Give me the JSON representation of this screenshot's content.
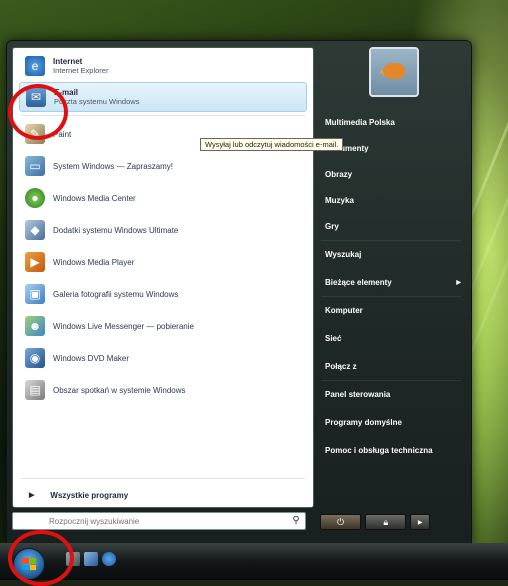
{
  "pinned": [
    {
      "title": "Internet",
      "subtitle": "Internet Explorer",
      "icon": "internet-explorer-icon"
    },
    {
      "title": "E-mail",
      "subtitle": "Poczta systemu Windows",
      "icon": "mail-icon"
    }
  ],
  "recent": [
    {
      "label": "Paint",
      "icon": "paint-icon"
    },
    {
      "label": "System Windows — Zapraszamy!",
      "icon": "welcome-icon"
    },
    {
      "label": "Windows Media Center",
      "icon": "media-center-icon"
    },
    {
      "label": "Dodatki systemu Windows Ultimate",
      "icon": "ultimate-extras-icon"
    },
    {
      "label": "Windows Media Player",
      "icon": "media-player-icon"
    },
    {
      "label": "Galeria fotografii systemu Windows",
      "icon": "photo-gallery-icon"
    },
    {
      "label": "Windows Live Messenger — pobieranie",
      "icon": "messenger-icon"
    },
    {
      "label": "Windows DVD Maker",
      "icon": "dvd-maker-icon"
    },
    {
      "label": "Obszar spotkań w systemie Windows",
      "icon": "meeting-space-icon"
    }
  ],
  "all_programs": "Wszystkie programy",
  "search": {
    "placeholder": "Rozpocznij wyszukiwanie"
  },
  "right_items": [
    "Multimedia Polska",
    "Dokumenty",
    "Obrazy",
    "Muzyka",
    "Gry",
    "Wyszukaj",
    "Bieżące elementy",
    "Komputer",
    "Sieć",
    "Połącz z",
    "Panel sterowania",
    "Programy domyślne",
    "Pomoc i obsługa techniczna"
  ],
  "tooltip": "Wysyłaj lub odczytuj wiadomości e-mail.",
  "colors": {
    "highlight_ring": "#e01010",
    "selected_bg": "#cde6f6",
    "menu_dark": "#1e2826"
  }
}
